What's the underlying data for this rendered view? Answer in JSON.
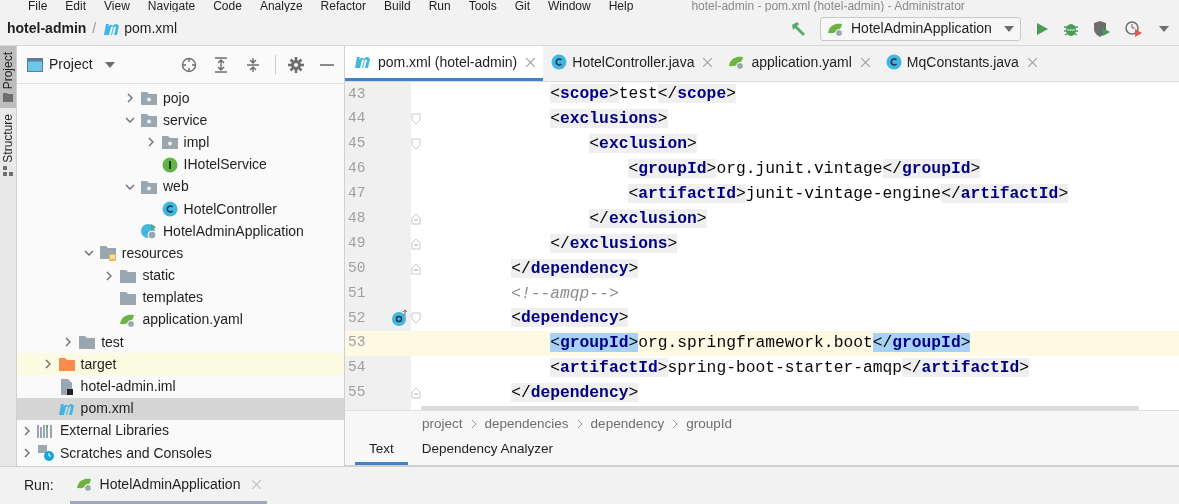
{
  "menu_bar": {
    "items": [
      "File",
      "Edit",
      "View",
      "Navigate",
      "Code",
      "Analyze",
      "Refactor",
      "Build",
      "Run",
      "Tools",
      "Git",
      "Window",
      "Help"
    ],
    "title": "hotel-admin - pom.xml (hotel-admin) - Administrator"
  },
  "nav_bar": {
    "breadcrumb": [
      {
        "label": "hotel-admin",
        "kind": "module"
      },
      {
        "label": "pom.xml",
        "kind": "maven"
      }
    ],
    "separator": "/",
    "run_config": "HotelAdminApplication"
  },
  "tool_stripe": [
    {
      "label": "Project",
      "selected": true
    },
    {
      "label": "Structure",
      "selected": false
    }
  ],
  "project_panel": {
    "title": "Project",
    "tree": [
      {
        "children": [
          {
            "children": [
              {
                "children": [
                  {
                    "children": [
                      {
                        "children": [
                          {
                            "label": "pojo",
                            "kind": "package",
                            "expanded": false,
                            "selected": false,
                            "highlighted": false
                          },
                          {
                            "label": "service",
                            "kind": "package",
                            "expanded": true,
                            "selected": false,
                            "highlighted": false,
                            "children": [
                              {
                                "label": "impl",
                                "kind": "package",
                                "expanded": false,
                                "selected": false,
                                "highlighted": false
                              },
                              {
                                "label": "IHotelService",
                                "kind": "interface",
                                "selected": false,
                                "highlighted": false
                              }
                            ]
                          },
                          {
                            "label": "web",
                            "kind": "package",
                            "expanded": true,
                            "selected": false,
                            "highlighted": false,
                            "children": [
                              {
                                "label": "HotelController",
                                "kind": "class",
                                "selected": false,
                                "highlighted": false
                              }
                            ]
                          },
                          {
                            "label": "HotelAdminApplication",
                            "kind": "spring-class",
                            "selected": false,
                            "highlighted": false
                          }
                        ]
                      }
                    ]
                  },
                  {
                    "label": "resources",
                    "kind": "resources",
                    "expanded": true,
                    "selected": false,
                    "highlighted": false,
                    "children": [
                      {
                        "label": "static",
                        "kind": "folder",
                        "expanded": false,
                        "selected": false,
                        "highlighted": false
                      },
                      {
                        "label": "templates",
                        "kind": "folder",
                        "selected": false,
                        "highlighted": false
                      },
                      {
                        "label": "application.yaml",
                        "kind": "spring",
                        "selected": false,
                        "highlighted": false
                      }
                    ]
                  }
                ]
              },
              {
                "label": "test",
                "kind": "folder",
                "expanded": false,
                "selected": false,
                "highlighted": false
              }
            ]
          },
          {
            "label": "target",
            "kind": "target",
            "expanded": false,
            "selected": false,
            "highlighted": true
          },
          {
            "label": "hotel-admin.iml",
            "kind": "iml",
            "selected": false,
            "highlighted": false
          },
          {
            "label": "pom.xml",
            "kind": "maven",
            "selected": true,
            "highlighted": false
          }
        ]
      },
      {
        "label": "External Libraries",
        "kind": "libraries",
        "expanded": false,
        "selected": false,
        "highlighted": false
      },
      {
        "label": "Scratches and Consoles",
        "kind": "scratches",
        "expanded": false,
        "selected": false,
        "highlighted": false
      }
    ]
  },
  "editor": {
    "tabs": [
      {
        "label": "pom.xml (hotel-admin)",
        "kind": "maven",
        "selected": true
      },
      {
        "label": "HotelController.java",
        "kind": "class",
        "selected": false
      },
      {
        "label": "application.yaml",
        "kind": "spring",
        "selected": false
      },
      {
        "label": "MqConstants.java",
        "kind": "class",
        "selected": false
      }
    ],
    "lines": [
      {
        "number": "43",
        "text": "            <scope>test</scope>",
        "current": false
      },
      {
        "number": "44",
        "text": "            <exclusions>",
        "current": false
      },
      {
        "number": "45",
        "text": "                <exclusion>",
        "current": false
      },
      {
        "number": "46",
        "text": "                    <groupId>org.junit.vintage</groupId>",
        "current": false
      },
      {
        "number": "47",
        "text": "                    <artifactId>junit-vintage-engine</artifactId>",
        "current": false
      },
      {
        "number": "48",
        "text": "                </exclusion>",
        "current": false
      },
      {
        "number": "49",
        "text": "            </exclusions>",
        "current": false
      },
      {
        "number": "50",
        "text": "        </dependency>",
        "current": false
      },
      {
        "number": "51",
        "text": "        <!--amqp-->",
        "current": false
      },
      {
        "number": "52",
        "text": "        <dependency>",
        "current": false,
        "gutter_icon": true
      },
      {
        "number": "53",
        "text": "            <groupId>org.springframework.boot</groupId>",
        "current": true,
        "tag_highlight": true
      },
      {
        "number": "54",
        "text": "            <artifactId>spring-boot-starter-amqp</artifactId>",
        "current": false
      },
      {
        "number": "55",
        "text": "        </dependency>",
        "current": false
      }
    ],
    "breadcrumb": [
      "project",
      "dependencies",
      "dependency",
      "groupId"
    ],
    "bottom_tabs": [
      {
        "label": "Text",
        "selected": true
      },
      {
        "label": "Dependency Analyzer",
        "selected": false
      }
    ]
  },
  "run_bar": {
    "label": "Run:",
    "tabs": [
      {
        "label": "HotelAdminApplication",
        "selected": true
      }
    ]
  }
}
